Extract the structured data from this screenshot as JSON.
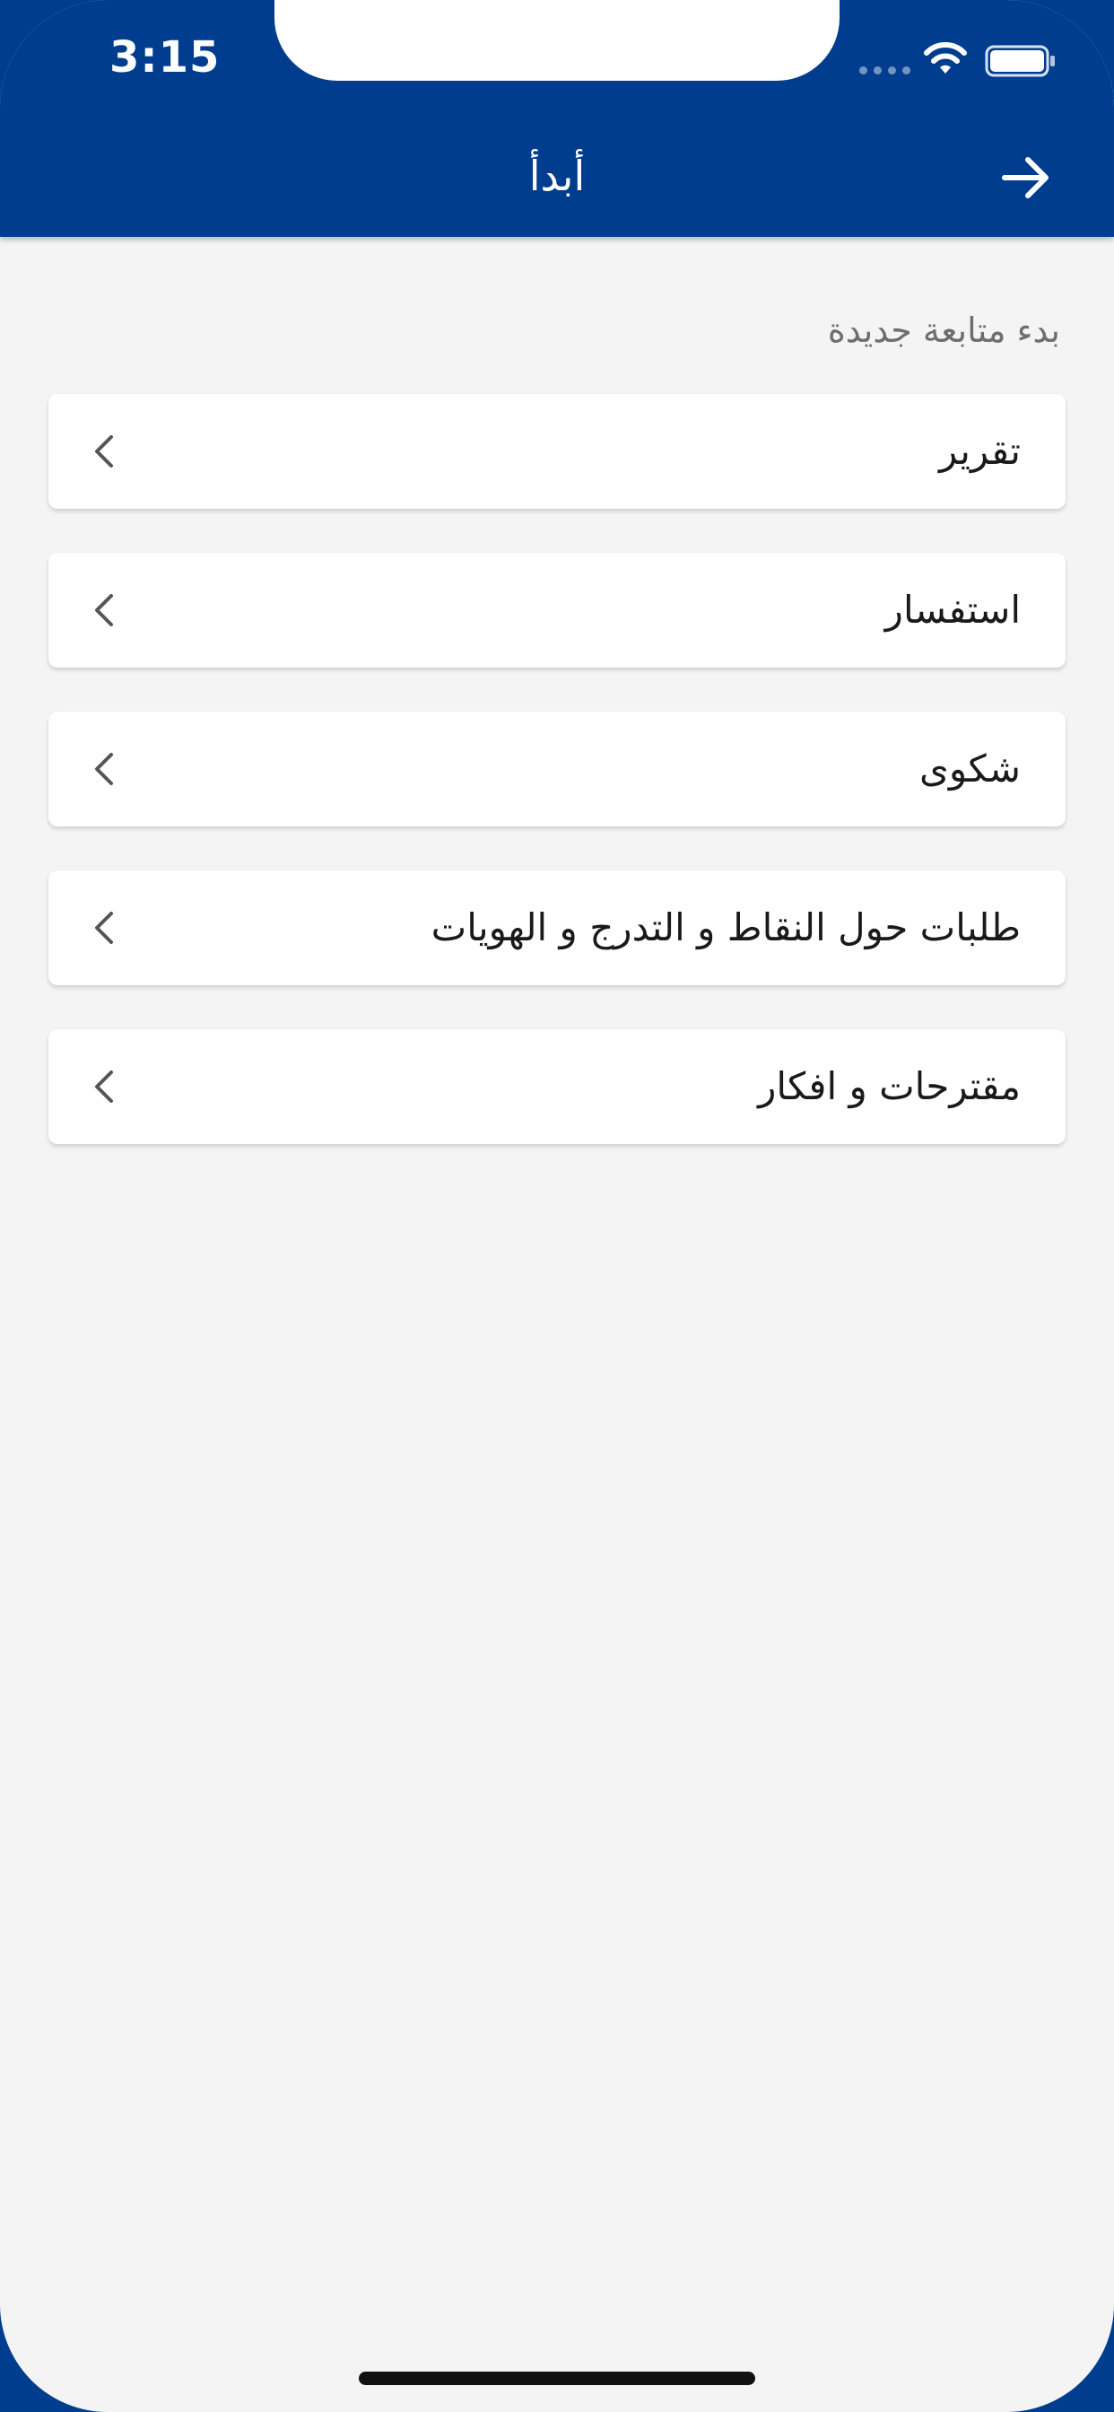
{
  "status_bar": {
    "time": "3:15"
  },
  "header": {
    "title": "أبدأ",
    "back_icon": "arrow-right-icon",
    "background_color": "#003d8f"
  },
  "section": {
    "label": "بدء متابعة جديدة"
  },
  "items": [
    {
      "label": "تقرير",
      "icon": "chevron-left-icon"
    },
    {
      "label": "استفسار",
      "icon": "chevron-left-icon"
    },
    {
      "label": "شكوى",
      "icon": "chevron-left-icon"
    },
    {
      "label": "طلبات حول النقاط و التدرج و الهويات",
      "icon": "chevron-left-icon"
    },
    {
      "label": "مقترحات و افكار",
      "icon": "chevron-left-icon"
    }
  ],
  "colors": {
    "brand": "#003d8f",
    "background": "#f4f4f4",
    "card": "#ffffff",
    "secondary_text": "#6e6e6e"
  }
}
